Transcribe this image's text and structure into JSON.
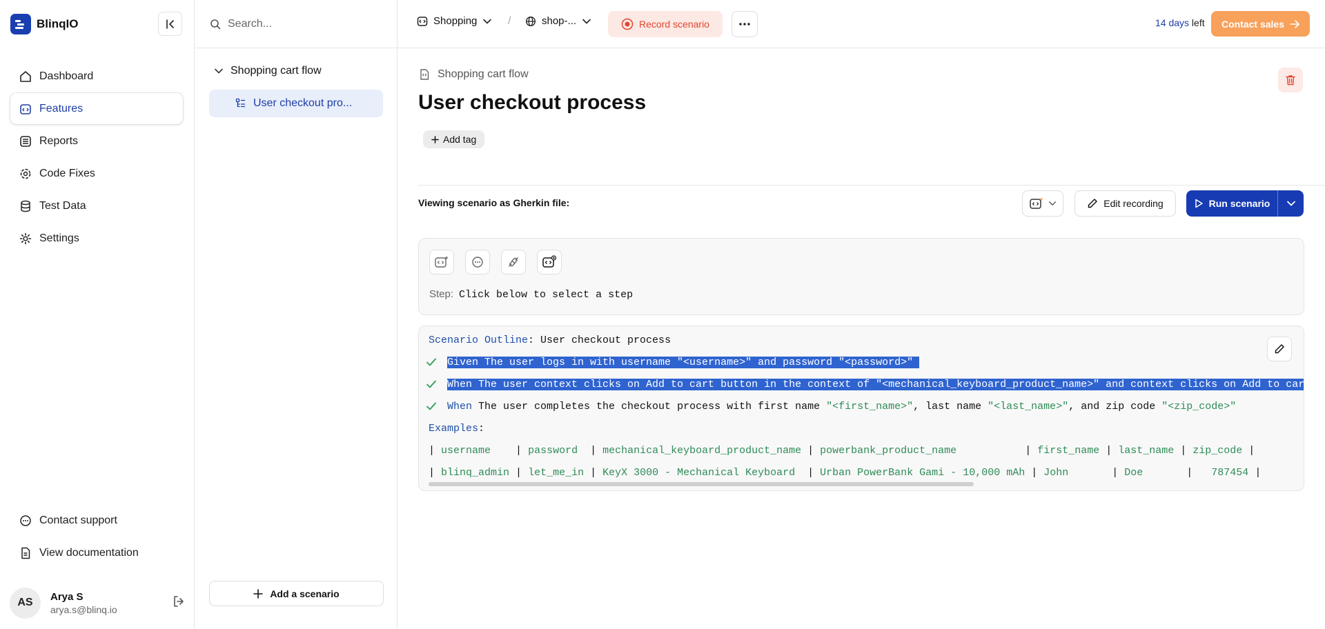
{
  "app": {
    "name": "BlinqIO"
  },
  "sidebar": {
    "items": [
      {
        "label": "Dashboard",
        "icon": "home-icon"
      },
      {
        "label": "Features",
        "icon": "features-icon",
        "active": true
      },
      {
        "label": "Reports",
        "icon": "reports-icon"
      },
      {
        "label": "Code Fixes",
        "icon": "gear-code-icon"
      },
      {
        "label": "Test Data",
        "icon": "database-icon"
      },
      {
        "label": "Settings",
        "icon": "settings-icon"
      }
    ],
    "bottom_items": [
      {
        "label": "Contact support",
        "icon": "chat-icon"
      },
      {
        "label": "View documentation",
        "icon": "document-icon"
      }
    ],
    "user": {
      "initials": "AS",
      "name": "Arya S",
      "email": "arya.s@blinq.io"
    }
  },
  "midpanel": {
    "search_placeholder": "Search...",
    "folder": "Shopping cart flow",
    "item": "User checkout pro...",
    "add_scenario": "Add a scenario"
  },
  "topbar": {
    "project": "Shopping",
    "environment": "shop-...",
    "record_label": "Record scenario",
    "trial_days": "14 days",
    "trial_suffix": " left",
    "contact_sales": "Contact sales"
  },
  "main": {
    "breadcrumb": "Shopping cart flow",
    "title": "User checkout process",
    "add_tag": "Add tag",
    "viewing_label": "Viewing scenario as Gherkin file:",
    "edit_recording": "Edit recording",
    "run_scenario": "Run scenario",
    "step_label": "Step:",
    "step_text": "Click below to select a step"
  },
  "gherkin": {
    "outline_kw": "Scenario Outline",
    "outline_title": ": User checkout process",
    "step1": "Given The user logs in with username \"<username>\" and password \"<password>\"",
    "step2": "When The user context clicks on Add to cart button in the context of \"<mechanical_keyboard_product_name>\" and context clicks on Add to cart",
    "step3_kw": "When",
    "step3_a": " The user completes the checkout process with first name ",
    "step3_b": "\"<first_name>\"",
    "step3_c": ", last name ",
    "step3_d": "\"<last_name>\"",
    "step3_e": ", and zip code ",
    "step3_f": "\"<zip_code>\"",
    "examples_kw": "Examples",
    "examples_colon": ":",
    "header_cells": [
      "username   ",
      "password ",
      "mechanical_keyboard_product_name",
      "powerbank_product_name          ",
      "first_name",
      "last_name",
      "zip_code"
    ],
    "row_cells": [
      "blinq_admin",
      "let_me_in",
      "KeyX 3000 - Mechanical Keyboard ",
      "Urban PowerBank Gami - 10,000 mAh",
      "John      ",
      "Doe      ",
      "  787454"
    ]
  },
  "colors": {
    "accent": "#163bb3",
    "record": "#e0452f",
    "contact_sales": "#f7a15b",
    "string": "#2e8b57",
    "keyword": "#1d4fa8"
  }
}
